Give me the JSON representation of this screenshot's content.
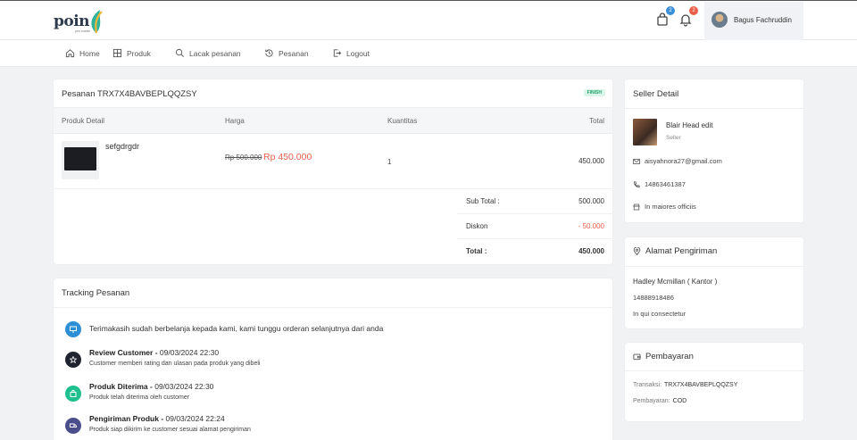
{
  "brand": {
    "logo_text": "poin",
    "logo_sub": "pen mobile"
  },
  "header": {
    "cart_badge": "2",
    "notif_badge": "2",
    "username": "Bagus Fachruddin",
    "colors": {
      "cart_badge": "#3b8fd9",
      "notif_badge": "#e8604c"
    }
  },
  "nav": {
    "home": "Home",
    "produk": "Produk",
    "lacak": "Lacak pesanan",
    "pesanan": "Pesanan",
    "logout": "Logout"
  },
  "order": {
    "title": "Pesanan TRX7X4BAVBEPLQQZSY",
    "status": "FINISH",
    "columns": {
      "product": "Produk Detail",
      "price": "Harga",
      "qty": "Kuantitas",
      "total": "Total"
    },
    "item": {
      "name": "sefgdrgdr",
      "price_old": "Rp 500.000",
      "price_new": "Rp 450.000",
      "qty": "1",
      "total": "450.000"
    },
    "summary": {
      "subtotal_label": "Sub Total :",
      "subtotal_value": "500.000",
      "discount_label": "Diskon",
      "discount_value": "- 50.000",
      "total_label": "Total :",
      "total_value": "450.000"
    }
  },
  "tracking": {
    "title": "Tracking Pesanan",
    "items": [
      {
        "title": "Terimakasih sudah berbelanja kepada kami, kami tunggu orderan selanjutnya dari anda",
        "date": "",
        "desc": "",
        "icon": "monitor-icon",
        "color": "#2d8fd5"
      },
      {
        "title": "Review Customer",
        "date": "09/03/2024 22:30",
        "desc": "Customer memberi rating dan ulasan pada produk yang dibeli",
        "icon": "star-icon",
        "color": "#1f2430"
      },
      {
        "title": "Produk Diterima",
        "date": "09/03/2024 22:30",
        "desc": "Produk telah diterima oleh customer",
        "icon": "bag-icon",
        "color": "#1fbf8f"
      },
      {
        "title": "Pengiriman Produk",
        "date": "09/03/2024 22:24",
        "desc": "Produk siap dikirim ke customer sesuai alamat pengiriman",
        "icon": "truck-icon",
        "color": "#4a4f8c"
      }
    ]
  },
  "seller": {
    "title": "Seller Detail",
    "name": "Blair Head edit",
    "role": "Seller",
    "email": "aisyahnora27@gmail.com",
    "phone": "14863461387",
    "store": "In maiores officiis"
  },
  "address": {
    "title": "Alamat Pengiriman",
    "name": "Hadley Mcmillan ( Kantor )",
    "phone": "14888918486",
    "text": "In qui consectetur"
  },
  "payment": {
    "title": "Pembayaran",
    "trx_label": "Transaksi:",
    "trx_value": "TRX7X4BAVBEPLQQZSY",
    "method_label": "Pembayaran:",
    "method_value": "COD"
  }
}
